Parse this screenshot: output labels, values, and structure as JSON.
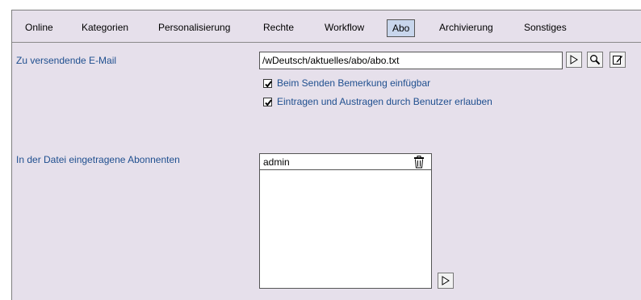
{
  "tabs": [
    {
      "label": "Online",
      "active": false
    },
    {
      "label": "Kategorien",
      "active": false
    },
    {
      "label": "Personalisierung",
      "active": false
    },
    {
      "label": "Rechte",
      "active": false
    },
    {
      "label": "Workflow",
      "active": false
    },
    {
      "label": "Abo",
      "active": true
    },
    {
      "label": "Archivierung",
      "active": false
    },
    {
      "label": "Sonstiges",
      "active": false
    }
  ],
  "email": {
    "label": "Zu versendende E-Mail",
    "value": "/wDeutsch/aktuelles/abo/abo.txt",
    "icons": [
      "pointer-select-icon",
      "magnifier-icon",
      "edit-icon"
    ]
  },
  "options": [
    {
      "label": "Beim Senden Bemerkung einfügbar",
      "checked": true
    },
    {
      "label": "Eintragen und Austragen durch Benutzer erlauben",
      "checked": true
    }
  ],
  "subscribers": {
    "label": "In der Datei eingetragene Abonnenten",
    "items": [
      "admin"
    ]
  },
  "colors": {
    "panel_bg": "#e6e0eb",
    "label_blue": "#1f4f8f",
    "active_tab_bg": "#c8d6ec"
  }
}
